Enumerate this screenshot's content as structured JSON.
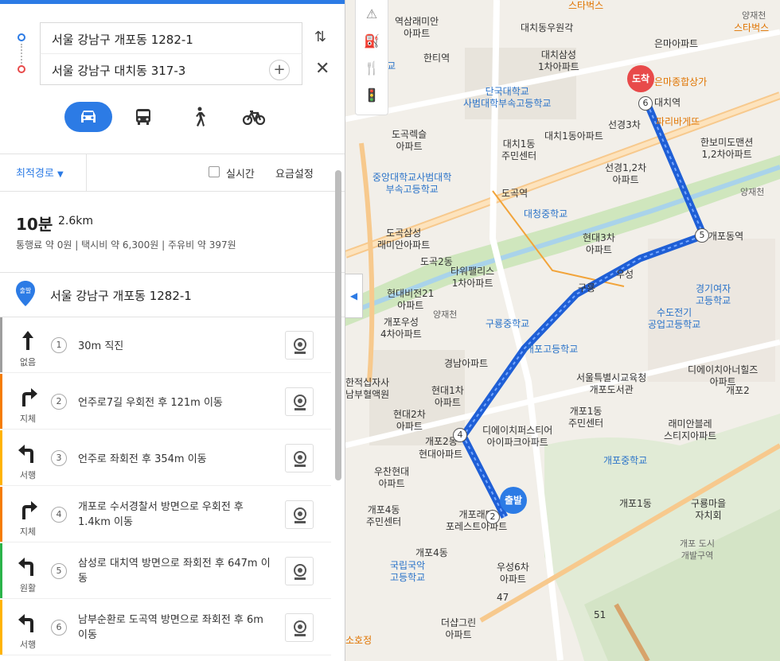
{
  "route": {
    "start_address": "서울 강남구 개포동 1282-1",
    "end_address": "서울 강남구 대치동 317-3"
  },
  "modes": [
    {
      "name": "car",
      "active": true
    },
    {
      "name": "bus",
      "active": false
    },
    {
      "name": "walk",
      "active": false
    },
    {
      "name": "bike",
      "active": false
    }
  ],
  "options": {
    "route_type": "최적경로",
    "realtime": "실시간",
    "fare_settings": "요금설정"
  },
  "summary": {
    "time": "10분",
    "distance": "2.6km",
    "costs": "통행료 약 0원  |  택시비 약 6,300원  |  주유비 약 397원"
  },
  "start_badge": "출발",
  "dest_badge": "도착",
  "steps": [
    {
      "num": "1",
      "traffic": "없음",
      "desc": "30m 직진",
      "color": "#9e9e9e",
      "turn": "straight"
    },
    {
      "num": "2",
      "traffic": "지체",
      "desc": "언주로7길 우회전 후 121m 이동",
      "color": "#f57c00",
      "turn": "right"
    },
    {
      "num": "3",
      "traffic": "서행",
      "desc": "언주로 좌회전 후 354m 이동",
      "color": "#ffb300",
      "turn": "left"
    },
    {
      "num": "4",
      "traffic": "지체",
      "desc": "개포로 수서경찰서 방면으로 우회전 후 1.4km 이동",
      "color": "#f57c00",
      "turn": "right"
    },
    {
      "num": "5",
      "traffic": "원활",
      "desc": "삼성로 대치역 방면으로 좌회전 후 647m 이동",
      "color": "#2bb34a",
      "turn": "left"
    },
    {
      "num": "6",
      "traffic": "서행",
      "desc": "남부순환로 도곡역 방면으로 좌회전 후 6m 이동",
      "color": "#ffb300",
      "turn": "left"
    }
  ],
  "map_labels": {
    "l1": "역삼래미안\n아파트",
    "l2": "대치동우원각",
    "l3": "스타벅스",
    "l4": "스타벅스",
    "l5": "한티역",
    "l6": "대치삼성\n1차아파트",
    "l7": "은마아파트",
    "l8": "중학교",
    "l9": "단국대학교\n사범대학부속고등학교",
    "l10": "은마종합상가",
    "l11": "대치역",
    "l12": "파리바게뜨",
    "l13": "도곡렉슬\n아파트",
    "l14": "대치1동\n주민센터",
    "l15": "대치1동아파트",
    "l16": "선경3차",
    "l17": "한보미도맨션\n1,2차아파트",
    "l18": "중앙대학교사범대학\n부속고등학교",
    "l19": "선경1,2차\n아파트",
    "l20": "도곡역",
    "l21": "대청중학교",
    "l22": "양재천",
    "l23": "도곡삼성\n래미안아파트",
    "l24": "현대3차\n아파트",
    "l25": "개포동역",
    "l26": "도곡2동",
    "l27": "타워팰리스\n1차아파트",
    "l28": "우성",
    "l29": "경기여자\n고등학교",
    "l30": "현대비전21\n아파트",
    "l31": "구룡",
    "l32": "양재천",
    "l33": "개포우성\n4차아파트",
    "l34": "구룡중학교",
    "l35": "수도전기\n공업고등학교",
    "l36": "개포고등학교",
    "l37": "경남아파트",
    "l38": "서울특별시교육청\n개포도서관",
    "l39": "디에이치아너힐즈\n아파트",
    "l40": "한적십자사\n남부혈액원",
    "l41": "현대1차\n아파트",
    "l42": "개포2동",
    "l43": "현대2차\n아파트",
    "l44": "디에이치퍼스티어\n아이파크아파트",
    "l45": "개포1동\n주민센터",
    "l46": "래미안블레\n스티지아파트",
    "l47": "개포2",
    "l48": "현대아파트",
    "l49": "개포중학교",
    "l50": "우찬현대\n아파트",
    "l51": "개포1동",
    "l52": "구룡마을\n자치회",
    "l53": "개포4동\n주민센터",
    "l54": "개포래미\n포레스트아파트",
    "l55": "개포 도시\n개발구역",
    "l56": "개포4동",
    "l57": "국립국악\n고등학교",
    "l58": "우성6차\n아파트",
    "l59": "더샵그린\n아파트",
    "l60": "소호정",
    "l61": "47",
    "l62": "51",
    "l63": "양재천"
  },
  "waypoints": [
    "2",
    "4",
    "5",
    "6"
  ]
}
